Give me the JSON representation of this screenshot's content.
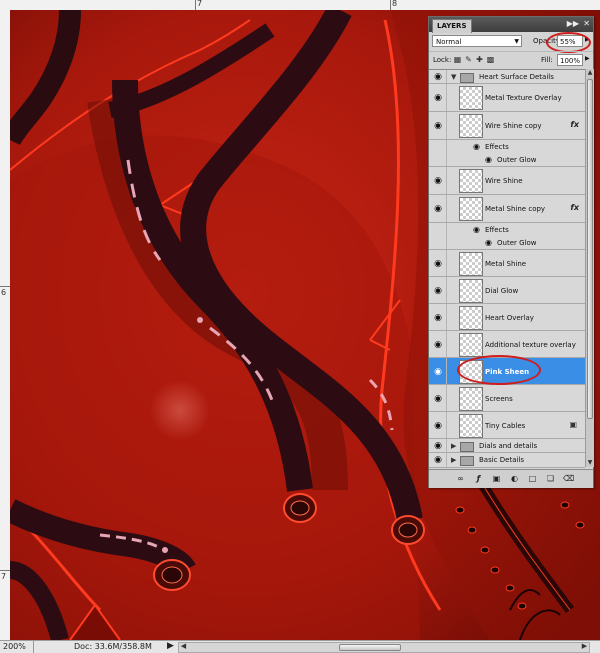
{
  "rulers": {
    "top_labels": [
      "7",
      "8"
    ],
    "left_labels": [
      "6",
      "7"
    ]
  },
  "status_bar": {
    "zoom": "200%",
    "doc": "Doc: 33.6M/358.8M"
  },
  "layers_panel": {
    "tab": "LAYERS",
    "blend_mode": "Normal",
    "opacity_label": "Opacity:",
    "opacity_value": "55%",
    "lock_label": "Lock:",
    "fill_label": "Fill:",
    "fill_value": "100%",
    "rows": [
      {
        "kind": "group",
        "name": "Heart Surface Details",
        "expanded": true,
        "visible": true
      },
      {
        "kind": "layer",
        "name": "Metal Texture Overlay",
        "visible": true
      },
      {
        "kind": "layer",
        "name": "Wire Shine copy",
        "visible": true,
        "fx": "fx"
      },
      {
        "kind": "effects",
        "name": "Effects"
      },
      {
        "kind": "effect",
        "name": "Outer Glow"
      },
      {
        "kind": "layer",
        "name": "Wire Shine",
        "visible": true
      },
      {
        "kind": "layer",
        "name": "Metal Shine copy",
        "visible": true,
        "fx": "fx"
      },
      {
        "kind": "effects",
        "name": "Effects"
      },
      {
        "kind": "effect",
        "name": "Outer Glow"
      },
      {
        "kind": "layer",
        "name": "Metal Shine",
        "visible": true
      },
      {
        "kind": "layer",
        "name": "Dial Glow",
        "visible": true
      },
      {
        "kind": "layer",
        "name": "Heart Overlay",
        "visible": true
      },
      {
        "kind": "layer",
        "name": "Additional texture overlay",
        "visible": true
      },
      {
        "kind": "layer",
        "name": "Pink Sheen",
        "visible": true,
        "selected": true
      },
      {
        "kind": "layer",
        "name": "Screens",
        "visible": true
      },
      {
        "kind": "layer",
        "name": "Tiny Cables",
        "visible": true,
        "locked": true
      },
      {
        "kind": "group",
        "name": "Dials and details",
        "expanded": false,
        "visible": true
      },
      {
        "kind": "group",
        "name": "Basic Details",
        "expanded": false,
        "visible": true
      }
    ]
  },
  "colors": {
    "canvas_red": "#b51a0e",
    "selection_blue": "#3a8ee6",
    "annotation_red": "#d11c1c"
  }
}
